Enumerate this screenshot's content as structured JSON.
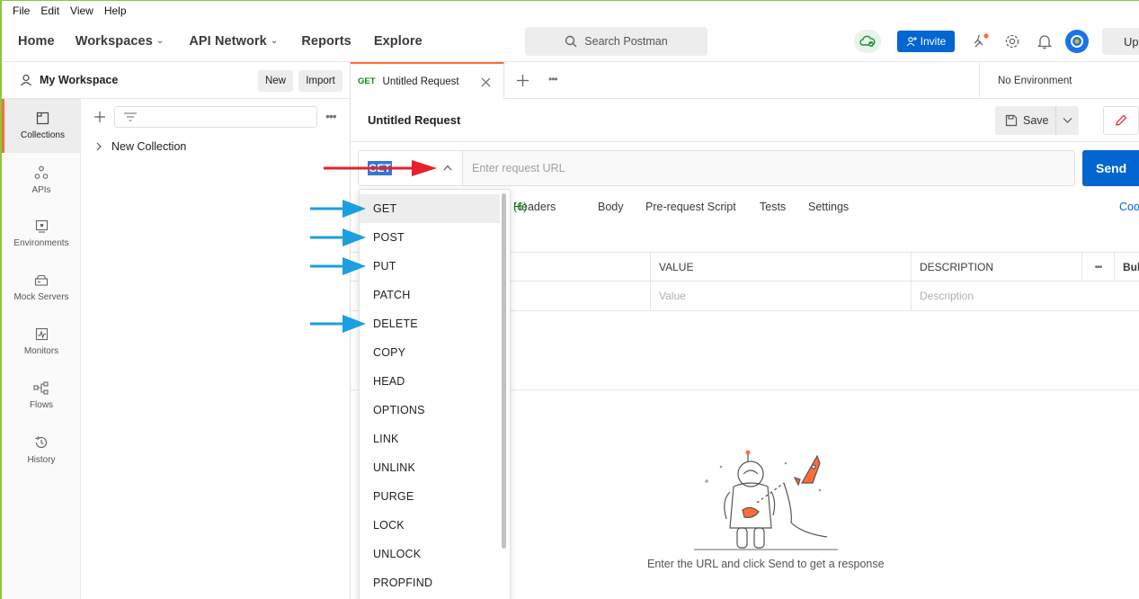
{
  "menubar": [
    "File",
    "Edit",
    "View",
    "Help"
  ],
  "nav": {
    "home": "Home",
    "workspaces": "Workspaces",
    "api_network": "API Network",
    "reports": "Reports",
    "explore": "Explore",
    "search_placeholder": "Search Postman",
    "invite": "Invite",
    "upgrade": "Upg"
  },
  "workspace": {
    "name": "My Workspace",
    "new_button": "New",
    "import_button": "Import"
  },
  "rail": [
    "Collections",
    "APIs",
    "Environments",
    "Mock Servers",
    "Monitors",
    "Flows",
    "History"
  ],
  "collections": {
    "item": "New Collection"
  },
  "tab": {
    "method": "GET",
    "title": "Untitled Request"
  },
  "environment": "No Environment",
  "request": {
    "title": "Untitled Request",
    "save": "Save",
    "method": "GET",
    "url_placeholder": "Enter request URL",
    "send": "Send"
  },
  "subtabs": {
    "headers": "Headers",
    "headers_count": "(6)",
    "body": "Body",
    "prerequest": "Pre-request Script",
    "tests": "Tests",
    "settings": "Settings",
    "cookies": "Coo"
  },
  "params_table": {
    "headers": [
      "VALUE",
      "DESCRIPTION",
      "Bul"
    ],
    "placeholders": [
      "Value",
      "Description"
    ]
  },
  "response": {
    "message": "Enter the URL and click Send to get a response"
  },
  "method_menu": [
    "GET",
    "POST",
    "PUT",
    "PATCH",
    "DELETE",
    "COPY",
    "HEAD",
    "OPTIONS",
    "LINK",
    "UNLINK",
    "PURGE",
    "LOCK",
    "UNLOCK",
    "PROPFIND"
  ],
  "colors": {
    "accent": "#ff6c37",
    "primary_blue": "#0265d2",
    "get_green": "#0e8a16",
    "annotation_red": "#e8202a",
    "annotation_blue": "#1a9fe0"
  }
}
